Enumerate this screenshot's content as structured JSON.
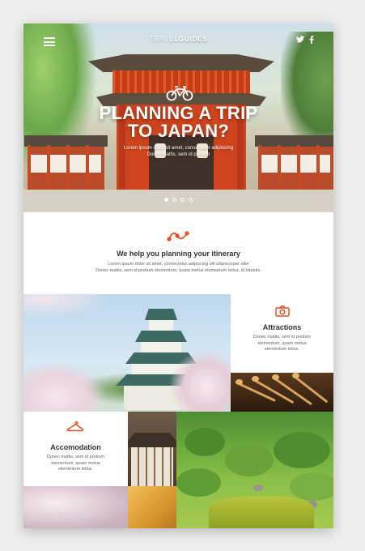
{
  "header": {
    "brand_light": "TRAVEL",
    "brand_bold": "GUIDES",
    "social": [
      "twitter-icon",
      "facebook-icon"
    ]
  },
  "hero": {
    "title_line1": "PLANNING A TRIP",
    "title_line2": "TO JAPAN?",
    "subtitle_line1": "Lorem ipsum dolor sit amet, consectetur adipiscing",
    "subtitle_line2": "Donec mattis, sem id pretium",
    "slides": 4,
    "active_slide": 1
  },
  "intro": {
    "title": "We help you planning your itinerary",
    "text_line1": "Lorem ipsum dolor sit amet, consectetur adipiscing elit ullamcorper allet",
    "text_line2": "Donec mattis, sem id pretium elementum, quam metus elementum tellus, id lobortis."
  },
  "attractions": {
    "title": "Attractions",
    "text_line1": "Donec mattis, sem id pretium",
    "text_line2": "elementum, quam metus",
    "text_line3": "elementum tellus."
  },
  "accomodation": {
    "title": "Accomodation",
    "text_line1": "Donec mattis, sem id pretium",
    "text_line2": "elementum, quam metus",
    "text_line3": "elementum tellus."
  },
  "colors": {
    "accent": "#e8501f",
    "gate_red": "#cf441d",
    "text_dark": "#333333",
    "text_muted": "#666666"
  },
  "icons": [
    "menu-icon",
    "bicycle-icon",
    "route-icon",
    "camera-icon",
    "hanger-icon"
  ]
}
